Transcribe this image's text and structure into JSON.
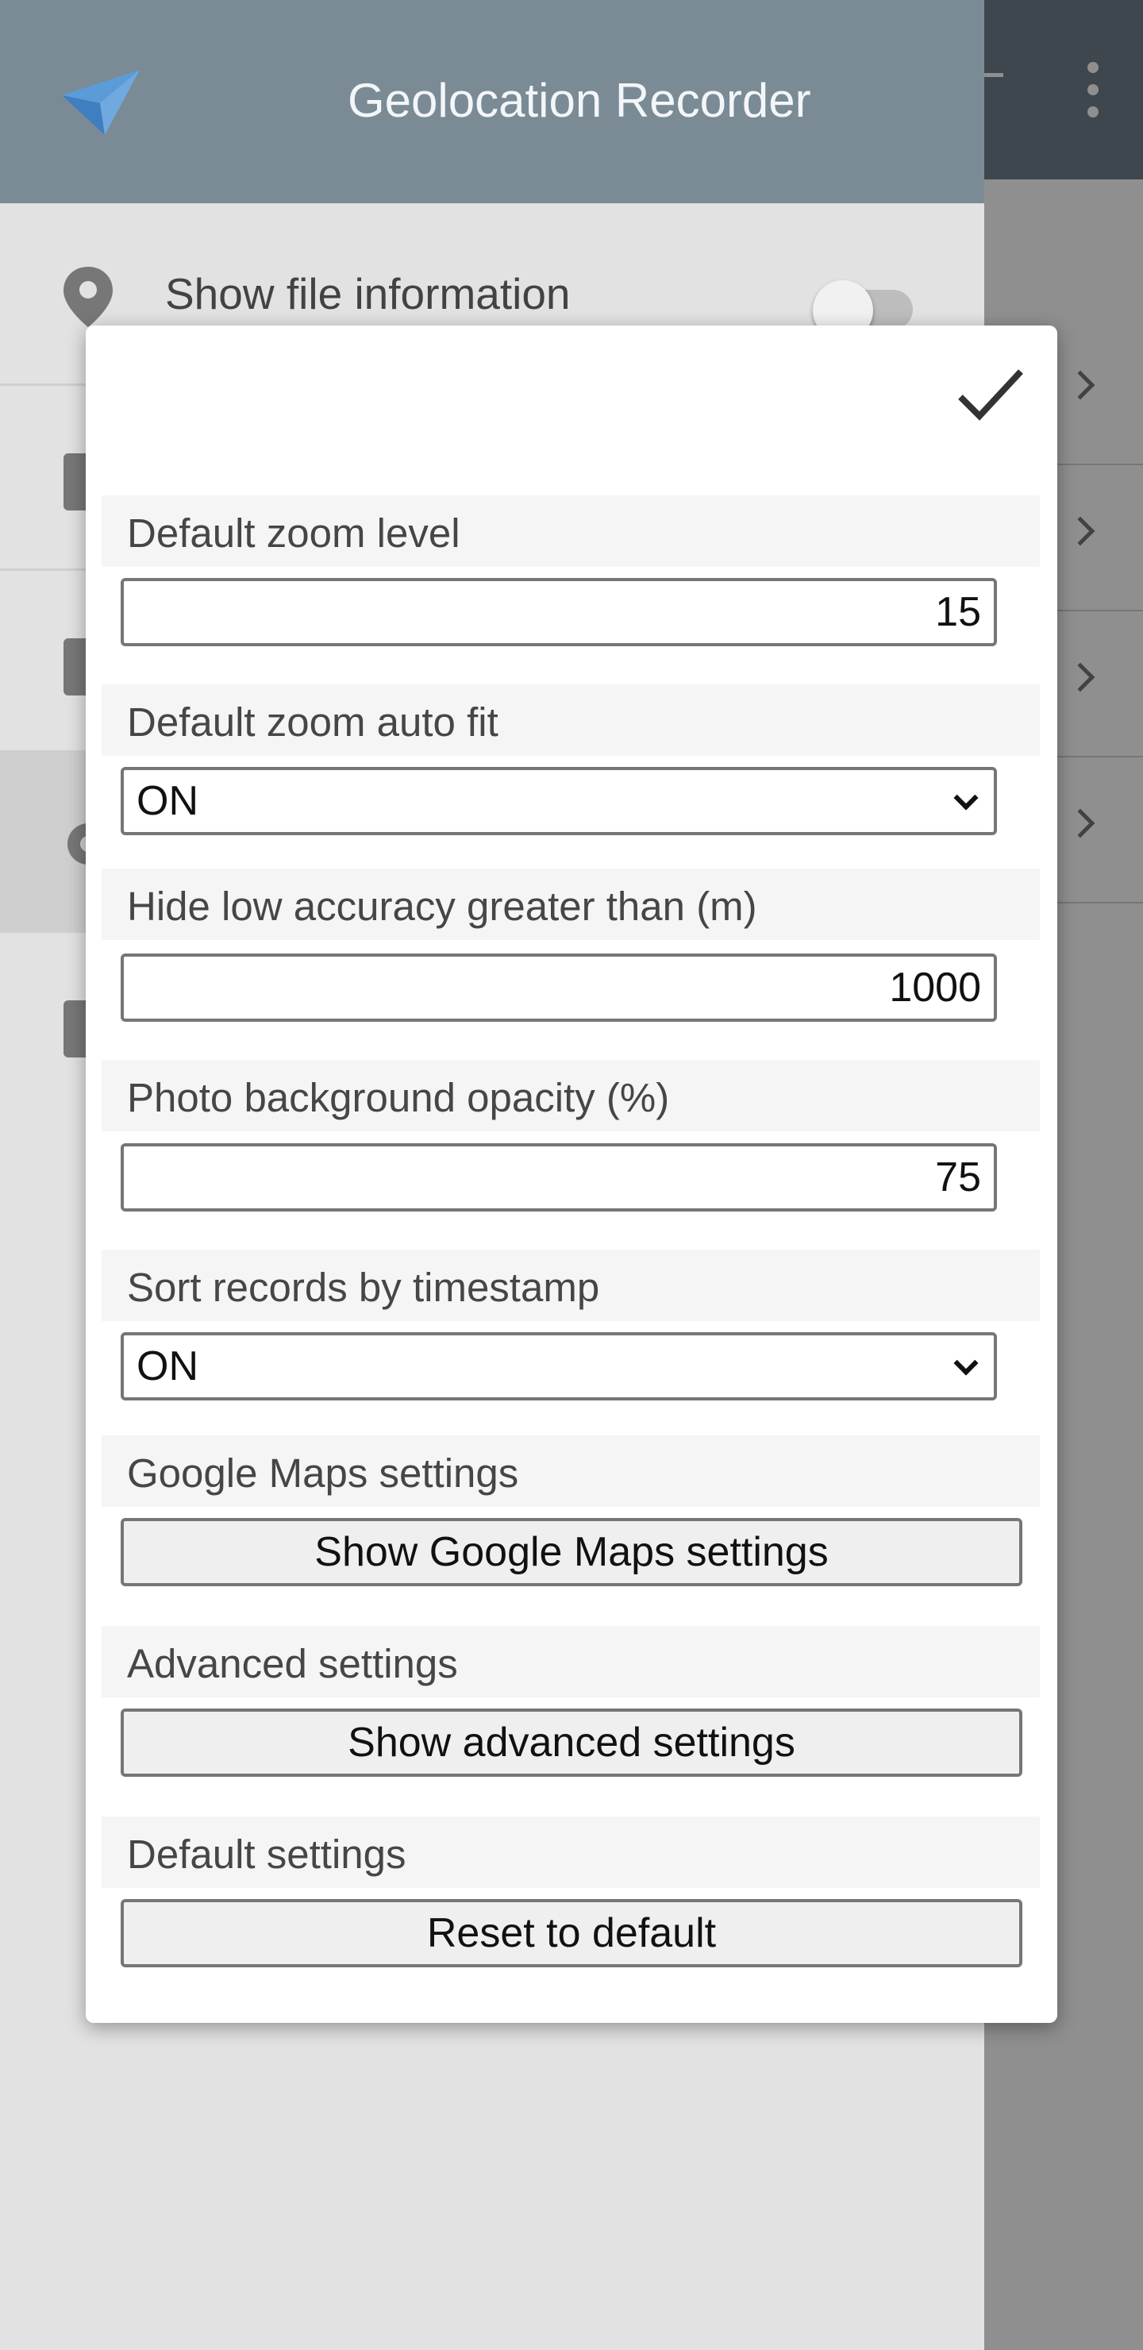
{
  "app": {
    "title": "Geolocation Recorder"
  },
  "drawer": {
    "header_title": "Geolocation Recorder",
    "items": [
      {
        "label": "Show file information",
        "icon": "location-pin-icon",
        "toggle": false
      },
      {
        "label": "",
        "icon": "upload-file-icon"
      },
      {
        "label": "",
        "icon": "download-file-icon"
      },
      {
        "label": "",
        "icon": "gear-icon",
        "selected": true
      },
      {
        "label": "",
        "icon": "document-icon"
      }
    ]
  },
  "dialog": {
    "confirm_icon": "checkmark-icon",
    "sections": {
      "zoom_level": {
        "label": "Default zoom level",
        "value": "15"
      },
      "zoom_auto_fit": {
        "label": "Default zoom auto fit",
        "value": "ON"
      },
      "hide_low_accuracy": {
        "label": "Hide low accuracy greater than (m)",
        "value": "1000"
      },
      "photo_opacity": {
        "label": "Photo background opacity (%)",
        "value": "75"
      },
      "sort_records": {
        "label": "Sort records by timestamp",
        "value": "ON"
      },
      "google_maps": {
        "label": "Google Maps settings",
        "button": "Show Google Maps settings"
      },
      "advanced": {
        "label": "Advanced settings",
        "button": "Show advanced settings"
      },
      "defaults": {
        "label": "Default settings",
        "button": "Reset to default"
      }
    }
  },
  "colors": {
    "app_bar": "#6f7f8b",
    "drawer_header": "#7a8b96",
    "drawer_bg": "#e2e2e2",
    "section_bg": "#f5f5f5"
  }
}
